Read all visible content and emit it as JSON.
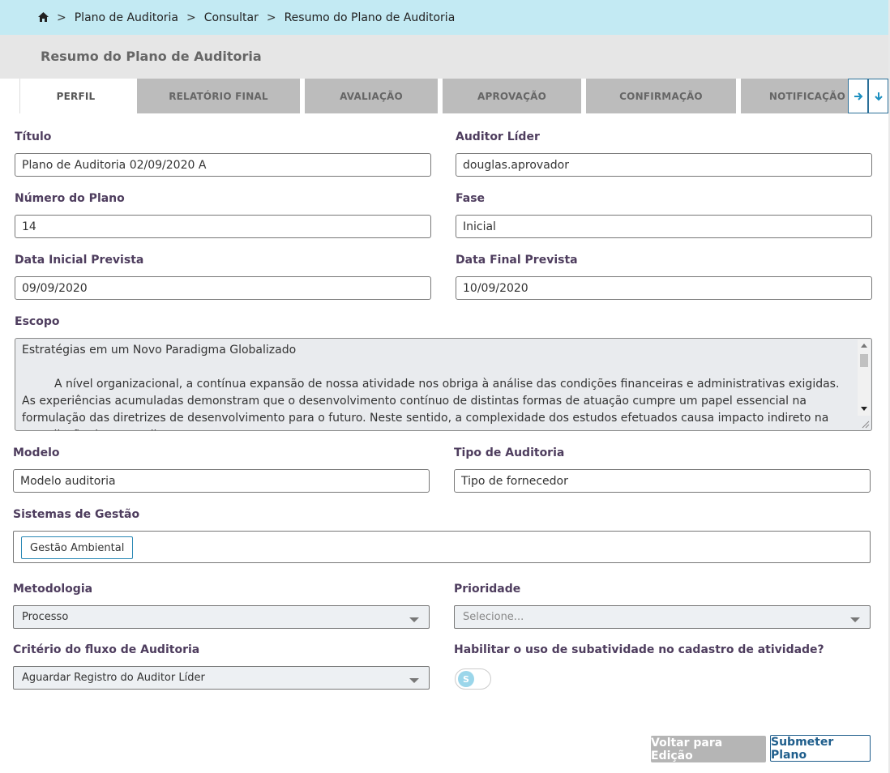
{
  "breadcrumb": {
    "home_icon": "home-icon",
    "separator": ">",
    "items": [
      "Plano de Auditoria",
      "Consultar",
      "Resumo do Plano de Auditoria"
    ]
  },
  "header": {
    "title": "Resumo do Plano de Auditoria"
  },
  "tabs": [
    {
      "label": "PERFIL",
      "active": true
    },
    {
      "label": "RELATÓRIO FINAL",
      "active": false
    },
    {
      "label": "AVALIAÇÃO",
      "active": false
    },
    {
      "label": "APROVAÇÃO",
      "active": false
    },
    {
      "label": "CONFIRMAÇÃO",
      "active": false
    },
    {
      "label": "NOTIFICAÇÃO",
      "active": false
    }
  ],
  "form": {
    "titulo": {
      "label": "Título",
      "value": "Plano de Auditoria 02/09/2020 A"
    },
    "auditor_lider": {
      "label": "Auditor Líder",
      "value": "douglas.aprovador"
    },
    "numero_plano": {
      "label": "Número do Plano",
      "value": "14"
    },
    "fase": {
      "label": "Fase",
      "value": "Inicial"
    },
    "data_inicial": {
      "label": "Data Inicial Prevista",
      "value": "09/09/2020"
    },
    "data_final": {
      "label": "Data Final Prevista",
      "value": "10/09/2020"
    },
    "escopo": {
      "label": "Escopo",
      "line1": "Estratégias em um Novo Paradigma Globalizado",
      "paragraph": "A nível organizacional, a contínua expansão de nossa atividade nos obriga à análise das condições financeiras e administrativas exigidas. As experiências acumuladas demonstram que o desenvolvimento contínuo de distintas formas de atuação cumpre um papel essencial na formulação das diretrizes de desenvolvimento para o futuro. Neste sentido, a complexidade dos estudos efetuados causa impacto indireto na reavaliação dos procedimentos"
    },
    "modelo": {
      "label": "Modelo",
      "value": "Modelo auditoria"
    },
    "tipo_auditoria": {
      "label": "Tipo de Auditoria",
      "value": "Tipo de fornecedor"
    },
    "sistemas_gestao": {
      "label": "Sistemas de Gestão",
      "tags": [
        "Gestão Ambiental"
      ]
    },
    "metodologia": {
      "label": "Metodologia",
      "value": "Processo"
    },
    "prioridade": {
      "label": "Prioridade",
      "placeholder": "Selecione..."
    },
    "criterio_fluxo": {
      "label": "Critério do fluxo de Auditoria",
      "value": "Aguardar Registro do Auditor Líder"
    },
    "habilitar_subatividade": {
      "label": "Habilitar o uso de subatividade no cadastro de atividade?",
      "toggle_text": "S"
    }
  },
  "actions": {
    "voltar": "Voltar para Edição",
    "submeter": "Submeter Plano"
  },
  "colors": {
    "breadcrumb_bg": "#c3eaf3",
    "label": "#4e3d5e",
    "accent": "#1f5e8c"
  }
}
